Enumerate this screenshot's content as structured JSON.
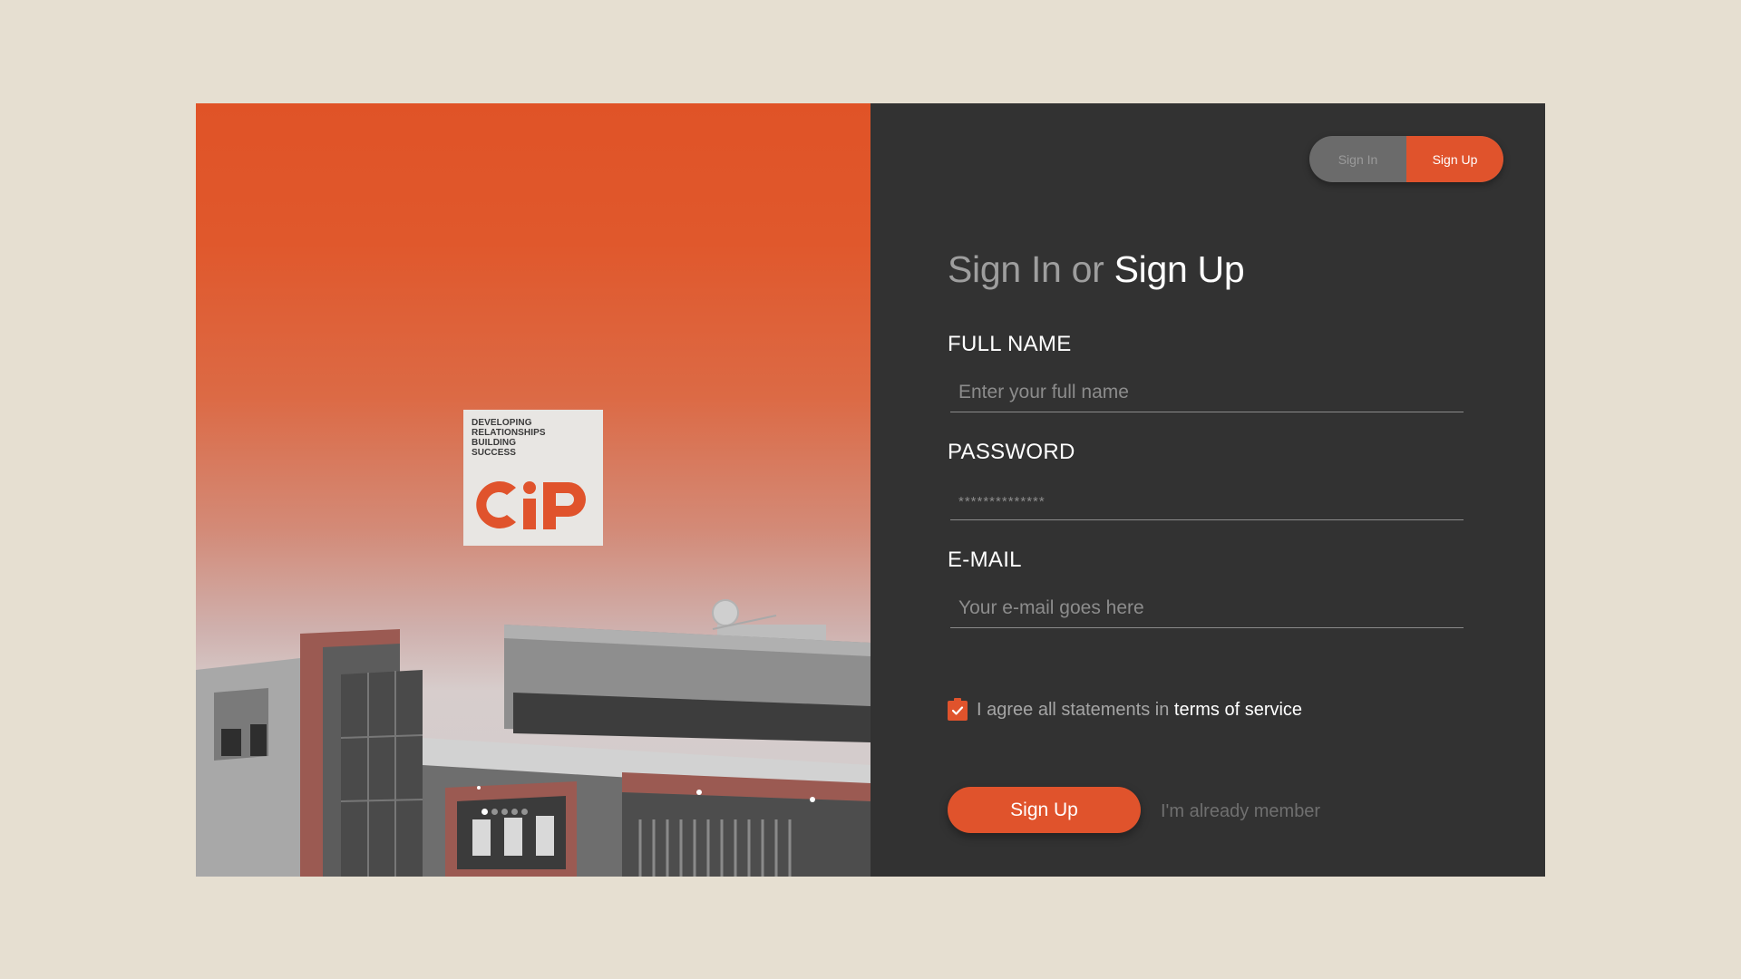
{
  "colors": {
    "accent": "#e0532c",
    "page_background": "#e6dfd1",
    "panel_background": "#323232"
  },
  "hero": {
    "logo": {
      "tagline": [
        "DEVELOPING",
        "RELATIONSHIPS",
        "BUILDING",
        "SUCCESS"
      ],
      "mark": "CIP"
    },
    "carousel": {
      "count": 5,
      "active": 0
    }
  },
  "toggle": {
    "sign_in": "Sign In",
    "sign_up": "Sign Up",
    "active": "sign_up"
  },
  "form": {
    "title_light": "Sign In",
    "title_or": "or",
    "title_strong": "Sign Up",
    "full_name": {
      "label": "FULL NAME",
      "placeholder": "Enter your full name",
      "value": ""
    },
    "password": {
      "label": "PASSWORD",
      "placeholder": "**************",
      "value": ""
    },
    "email": {
      "label": "E-MAIL",
      "placeholder": "Your e-mail goes here",
      "value": ""
    },
    "agree": {
      "checked": true,
      "text": "I agree all statements in",
      "link": "terms of service"
    },
    "submit_label": "Sign Up",
    "member_link": "I'm already member"
  },
  "icons": {
    "checkbox": "clipboard-check-icon"
  }
}
